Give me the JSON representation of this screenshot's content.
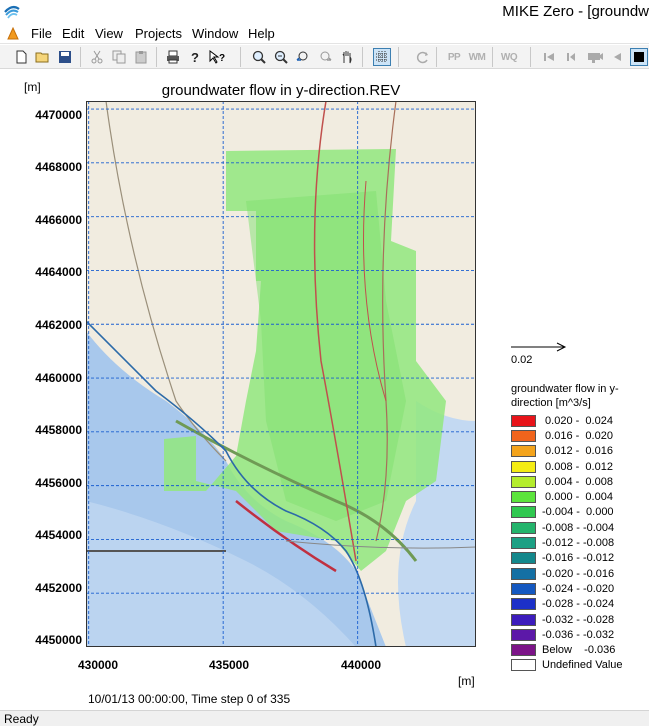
{
  "window": {
    "title": "MIKE Zero - [groundw"
  },
  "menu": {
    "items": [
      "File",
      "Edit",
      "View",
      "Projects",
      "Window",
      "Help"
    ]
  },
  "toolbar": {
    "icons": [
      "new-icon",
      "open-icon",
      "save-icon",
      "cut-icon",
      "copy-icon",
      "paste-icon",
      "print-icon",
      "help-icon",
      "context-help-icon",
      "zoom-in-icon",
      "zoom-out-icon",
      "zoom-previous-icon",
      "zoom-next-icon",
      "pan-icon",
      "grid-icon",
      "refresh-icon",
      "play-back-icon",
      "step-back-icon",
      "camera-icon",
      "play-reverse-icon",
      "stop-icon"
    ],
    "text_buttons": [
      "PP",
      "WM",
      "WQ"
    ]
  },
  "plot": {
    "title": "groundwater flow in y-direction.REV",
    "y_unit": "[m]",
    "x_unit": "[m]",
    "y_ticks": [
      "4470000",
      "4468000",
      "4466000",
      "4464000",
      "4462000",
      "4460000",
      "4458000",
      "4456000",
      "4454000",
      "4452000",
      "4450000"
    ],
    "x_ticks": [
      "430000",
      "435000",
      "440000"
    ],
    "time_step": "10/01/13 00:00:00, Time step 0 of 335"
  },
  "chart_data": {
    "type": "heatmap",
    "title": "groundwater flow in y-direction.REV",
    "xlabel": "[m]",
    "ylabel": "[m]",
    "xlim": [
      429900,
      444400
    ],
    "ylim": [
      4450000,
      4470300
    ],
    "x_ticks": [
      430000,
      435000,
      440000
    ],
    "y_ticks": [
      4450000,
      4452000,
      4454000,
      4456000,
      4458000,
      4460000,
      4462000,
      4464000,
      4466000,
      4468000,
      4470000
    ],
    "grid": true,
    "vector_scale": 0.02
  },
  "scale_arrow": {
    "label": "0.02"
  },
  "legend": {
    "title": "groundwater flow in y-direction [m^3/s]",
    "entries": [
      {
        "label": " 0.020 -  0.024",
        "color": "#e8141a"
      },
      {
        "label": " 0.016 -  0.020",
        "color": "#f0641c"
      },
      {
        "label": " 0.012 -  0.016",
        "color": "#f4a41c"
      },
      {
        "label": " 0.008 -  0.012",
        "color": "#f4ec14"
      },
      {
        "label": " 0.004 -  0.008",
        "color": "#b4ec2c"
      },
      {
        "label": " 0.000 -  0.004",
        "color": "#5ce43c"
      },
      {
        "label": "-0.004 -  0.000",
        "color": "#30c850"
      },
      {
        "label": "-0.008 - -0.004",
        "color": "#24b46c"
      },
      {
        "label": "-0.012 - -0.008",
        "color": "#1ca084"
      },
      {
        "label": "-0.016 - -0.012",
        "color": "#14888c"
      },
      {
        "label": "-0.020 - -0.016",
        "color": "#1470a4"
      },
      {
        "label": "-0.024 - -0.020",
        "color": "#1458c0"
      },
      {
        "label": "-0.028 - -0.024",
        "color": "#1c30c8"
      },
      {
        "label": "-0.032 - -0.028",
        "color": "#3c1cbc"
      },
      {
        "label": "-0.036 - -0.032",
        "color": "#5c18a8"
      },
      {
        "label": "Below    -0.036",
        "color": "#7c1488"
      },
      {
        "label": "Undefined Value",
        "color": "#ffffff"
      }
    ]
  },
  "status": {
    "text": "Ready"
  }
}
